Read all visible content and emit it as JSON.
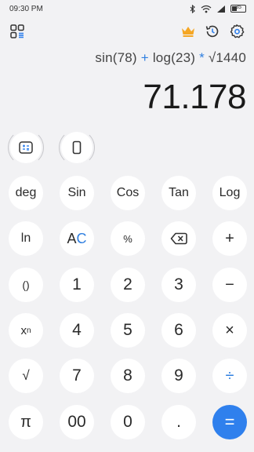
{
  "status": {
    "time": "09:30 PM",
    "battery": "35"
  },
  "colors": {
    "accent": "#2f80ed",
    "crown": "#f5a623",
    "op_text": "#2f7fe0"
  },
  "expression": {
    "part1": "sin(78)",
    "op1": "+",
    "part2": "log(23)",
    "op2": "*",
    "part3": "√1440"
  },
  "result": "71.178",
  "icons": {
    "top_left": "layout-grid-icon",
    "premium": "crown-icon",
    "history": "history-icon",
    "settings": "gear-icon",
    "mode1": "calculator-mode-icon",
    "mode2": "rotate-phone-icon",
    "backspace": "backspace-icon"
  },
  "keys": {
    "row1": [
      "deg",
      "Sin",
      "Cos",
      "Tan",
      "Log"
    ],
    "row2": {
      "ln": "ln",
      "ac_a": "A",
      "ac_c": "C",
      "percent": "%",
      "plus": "+"
    },
    "row3": {
      "paren": "()",
      "one": "1",
      "two": "2",
      "three": "3",
      "minus": "−"
    },
    "row4": {
      "pow_base": "x",
      "pow_exp": "n",
      "four": "4",
      "five": "5",
      "six": "6",
      "times": "×"
    },
    "row5": {
      "sqrt": "√",
      "seven": "7",
      "eight": "8",
      "nine": "9",
      "divide": "÷"
    },
    "row6": {
      "pi": "π",
      "double_zero": "00",
      "zero": "0",
      "dot": ".",
      "equals": "="
    }
  }
}
